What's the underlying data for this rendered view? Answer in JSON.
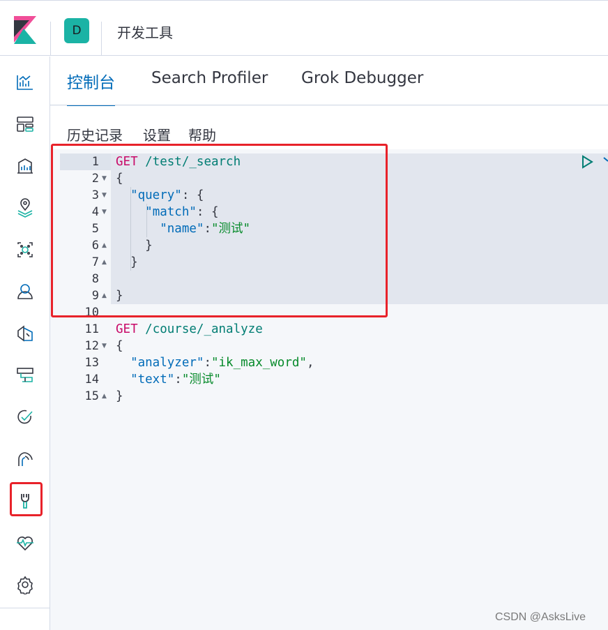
{
  "header": {
    "logo_icon": "kibana-logo-icon",
    "space_initial": "D",
    "title": "开发工具"
  },
  "sidenav": {
    "items": [
      {
        "name": "discover-icon"
      },
      {
        "name": "dashboard-icon"
      },
      {
        "name": "canvas-icon"
      },
      {
        "name": "maps-icon"
      },
      {
        "name": "ml-icon"
      },
      {
        "name": "metrics-icon"
      },
      {
        "name": "logs-icon"
      },
      {
        "name": "apm-icon"
      },
      {
        "name": "uptime-icon"
      },
      {
        "name": "siem-icon"
      },
      {
        "name": "dev-tools-icon"
      },
      {
        "name": "monitoring-icon"
      },
      {
        "name": "management-icon"
      }
    ],
    "active": "dev-tools-icon"
  },
  "tabs": [
    {
      "label": "控制台",
      "active": true
    },
    {
      "label": "Search Profiler",
      "active": false
    },
    {
      "label": "Grok Debugger",
      "active": false
    }
  ],
  "toolbar": {
    "history": "历史记录",
    "settings": "设置",
    "help": "帮助"
  },
  "editor": {
    "lines": [
      {
        "n": "1"
      },
      {
        "n": "2"
      },
      {
        "n": "3"
      },
      {
        "n": "4"
      },
      {
        "n": "5"
      },
      {
        "n": "6"
      },
      {
        "n": "7"
      },
      {
        "n": "8"
      },
      {
        "n": "9"
      },
      {
        "n": "10"
      },
      {
        "n": "11"
      },
      {
        "n": "12"
      },
      {
        "n": "13"
      },
      {
        "n": "14"
      },
      {
        "n": "15"
      }
    ],
    "req1_method": "GET",
    "req1_path": "/test/_search",
    "query_key": "\"query\"",
    "match_key": "\"match\"",
    "name_key": "\"name\"",
    "name_val": "\"测试\"",
    "req2_method": "GET",
    "req2_path": "/course/_analyze",
    "analyzer_key": "\"analyzer\"",
    "analyzer_val": "\"ik_max_word\"",
    "text_key": "\"text\"",
    "text_val": "\"测试\"",
    "open_brace": "{",
    "close_brace": "}",
    "colon": ":",
    "colon_space": ": ",
    "comma": ",",
    "run_icon": "play-icon",
    "wrench_icon": "wrench-icon"
  },
  "watermark": "CSDN @AsksLive",
  "colors": {
    "accent": "#006bb8",
    "teal": "#1bb3a5",
    "method": "#c80a68",
    "highlight": "#e8222a"
  }
}
